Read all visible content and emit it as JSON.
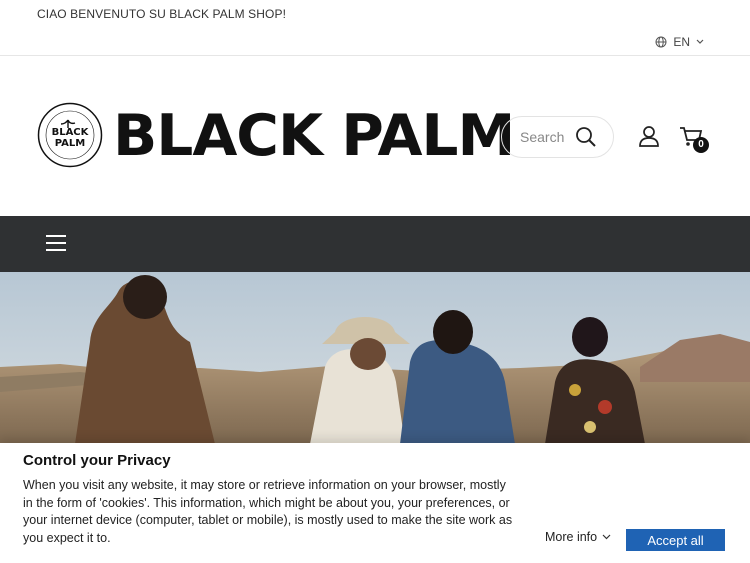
{
  "topbar": {
    "welcome": "CIAO BENVENUTO SU BLACK PALM SHOP!",
    "language": "EN"
  },
  "header": {
    "logo_text": "BLACK PALM",
    "logo_badge_text": "BLACK PALM",
    "logo_badge_ring": "SNEAKERS AND STREETWEAR",
    "search_placeholder": "Search",
    "cart_count": "0"
  },
  "hero": {
    "description": ""
  },
  "cookie": {
    "title": "Control your Privacy",
    "body": "When you visit any website, it may store or retrieve information on your browser, mostly in the form of 'cookies'. This information, which might be about you, your preferences, or your internet device (computer, tablet or mobile), is mostly used to make the site work as you expect it to.",
    "more_info": "More info",
    "accept": "Accept all"
  },
  "colors": {
    "navbar": "#2f3133",
    "accent": "#1f63b4"
  }
}
